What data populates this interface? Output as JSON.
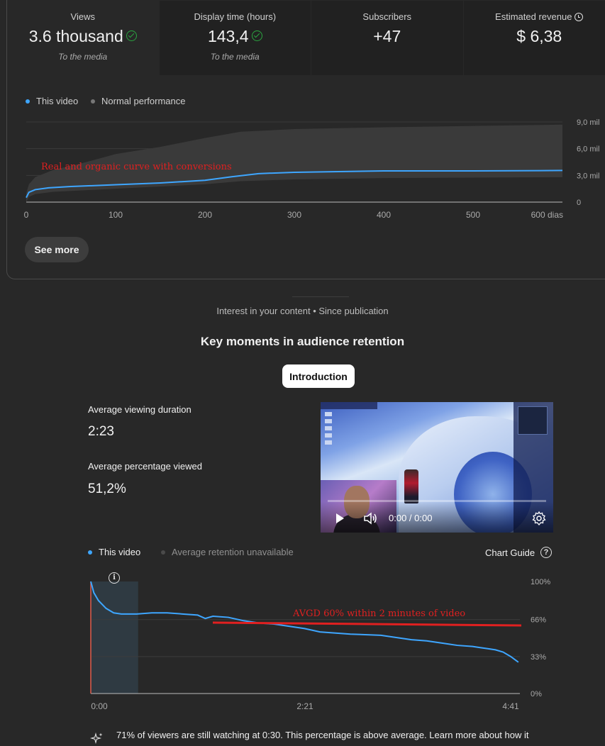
{
  "metrics": [
    {
      "label": "Views",
      "value": "3.6 thousand",
      "sub": "To the media"
    },
    {
      "label": "Display time (hours)",
      "value": "143,4",
      "sub": "To the media"
    },
    {
      "label": "Subscribers",
      "value": "+47",
      "sub": ""
    },
    {
      "label": "Estimated revenue",
      "value": "$ 6,38",
      "sub": ""
    }
  ],
  "views_chart": {
    "legend": {
      "this_video": "This video",
      "normal": "Normal performance"
    },
    "annotation": "Real and organic curve with conversions",
    "button": "See more",
    "colors": {
      "this_video": "#3ea6ff",
      "band": "#3a3a3a",
      "annotation": "#e02020"
    }
  },
  "retention": {
    "caption": "Interest in your content • Since publication",
    "heading": "Key moments in audience retention",
    "tab": "Introduction",
    "stats": {
      "avg_duration_label": "Average viewing duration",
      "avg_duration_value": "2:23",
      "avg_percentage_label": "Average percentage viewed",
      "avg_percentage_value": "51,2%"
    },
    "video": {
      "time": "0:00 / 0:00"
    },
    "legend": {
      "this_video": "This video",
      "avg_unavailable": "Average retention unavailable"
    },
    "chart_guide": "Chart Guide",
    "annotation": "AVGD 60% within 2 minutes of video",
    "insight": "71% of viewers are still watching at 0:30. This percentage is above average. Learn more about how it"
  },
  "chart_data": [
    {
      "type": "area",
      "x_unit": "dias",
      "x_ticks": [
        "0",
        "100",
        "200",
        "300",
        "400",
        "500",
        "600 dias"
      ],
      "y_ticks": [
        "9,0 mil",
        "6,0 mil",
        "3,0 mil",
        "0"
      ],
      "xlim": [
        0,
        600
      ],
      "ylim": [
        0,
        9000
      ],
      "series": [
        {
          "name": "This video",
          "x": [
            0,
            3,
            10,
            25,
            50,
            100,
            150,
            200,
            230,
            260,
            300,
            400,
            500,
            600
          ],
          "y": [
            500,
            1100,
            1400,
            1600,
            1750,
            1950,
            2150,
            2450,
            2850,
            3200,
            3350,
            3500,
            3500,
            3550
          ]
        },
        {
          "name": "Normal performance",
          "x": [
            0,
            3,
            10,
            30,
            60,
            100,
            150,
            200,
            240,
            300,
            400,
            500,
            600
          ],
          "lower": [
            0,
            600,
            900,
            1150,
            1300,
            1500,
            1750,
            2000,
            2350,
            2550,
            2700,
            2750,
            2800
          ],
          "upper": [
            1000,
            2000,
            2800,
            3600,
            4300,
            5400,
            6200,
            7200,
            7900,
            8200,
            8400,
            8550,
            8700
          ]
        }
      ]
    },
    {
      "type": "line",
      "x_ticks": [
        "0:00",
        "2:21",
        "4:41"
      ],
      "y_ticks": [
        "100%",
        "66%",
        "33%",
        "0%"
      ],
      "xlim": [
        0,
        281
      ],
      "ylim": [
        0,
        100
      ],
      "series": [
        {
          "name": "This video",
          "x": [
            0,
            2,
            5,
            10,
            15,
            20,
            25,
            30,
            40,
            50,
            60,
            70,
            75,
            80,
            90,
            100,
            110,
            120,
            140,
            150,
            170,
            190,
            200,
            210,
            220,
            230,
            240,
            250,
            255,
            260,
            265,
            270,
            275,
            280
          ],
          "y": [
            100,
            90,
            83,
            76,
            72,
            71,
            71,
            71,
            72,
            72,
            71,
            70,
            67,
            69,
            68,
            65,
            63,
            62,
            58,
            55,
            53,
            52,
            50,
            48,
            47,
            45,
            43,
            42,
            41,
            40,
            39,
            37,
            33,
            28
          ]
        }
      ]
    }
  ]
}
